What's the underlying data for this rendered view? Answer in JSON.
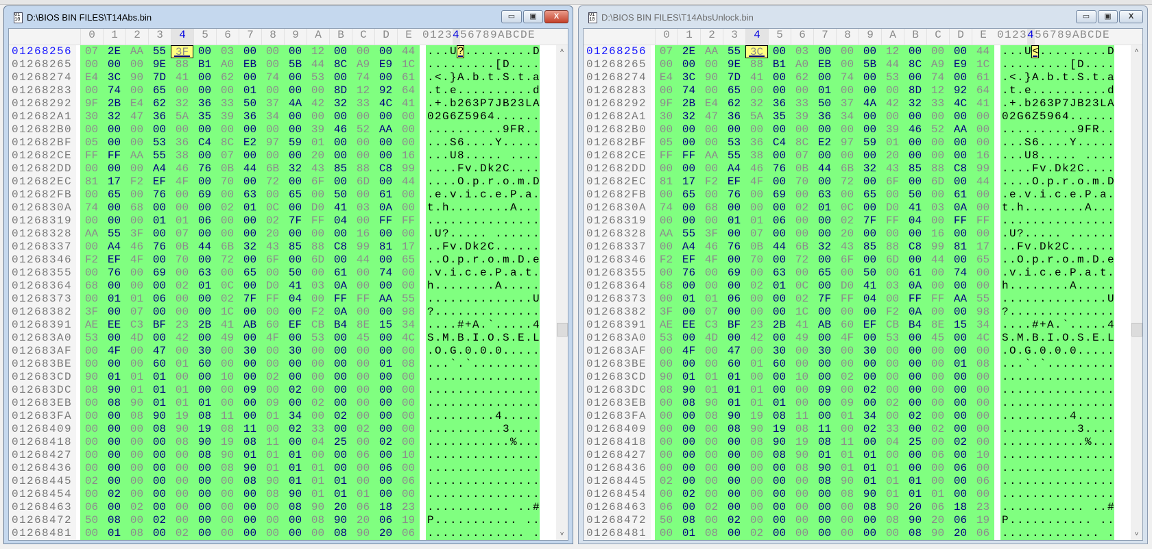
{
  "columns": [
    "0",
    "1",
    "2",
    "3",
    "4",
    "5",
    "6",
    "7",
    "8",
    "9",
    "A",
    "B",
    "C",
    "D",
    "E"
  ],
  "ascii_header": "0123456789ABCDE",
  "cursor_column": 4,
  "window_buttons": {
    "minimize": "▭",
    "maximize": "▣",
    "close": "X"
  },
  "scrollbar": {
    "up": "˄",
    "down": "˅",
    "position_fraction": 0.55
  },
  "colors": {
    "data_bg": "#80ff80",
    "even_col": "#8c8c8c",
    "odd_col": "#000080",
    "cursor_bg": "#ffff80"
  },
  "panes": [
    {
      "title": "D:\\BIOS BIN FILES\\T14Abs.bin",
      "active": true,
      "rows": [
        {
          "addr": "01268256",
          "hex": "07 2E AA 55 3F 00 03 00 00 00 12 00 00 00 44",
          "ascii": "...U?.........D"
        },
        {
          "addr": "01268265",
          "hex": "00 00 00 9E 88 B1 A0 EB 00 5B 44 8C A9 E9 1C",
          "ascii": ".........[D...."
        },
        {
          "addr": "01268274",
          "hex": "E4 3C 90 7D 41 00 62 00 74 00 53 00 74 00 61",
          "ascii": ".<.}A.b.t.S.t.a"
        },
        {
          "addr": "01268283",
          "hex": "00 74 00 65 00 00 00 01 00 00 00 8D 12 92 64",
          "ascii": ".t.e..........d"
        },
        {
          "addr": "01268292",
          "hex": "9F 2B E4 62 32 36 33 50 37 4A 42 32 33 4C 41",
          "ascii": ".+.b263P7JB23LA"
        },
        {
          "addr": "012682A1",
          "hex": "30 32 47 36 5A 35 39 36 34 00 00 00 00 00 00",
          "ascii": "02G6Z5964......"
        },
        {
          "addr": "012682B0",
          "hex": "00 00 00 00 00 00 00 00 00 00 39 46 52 AA 00",
          "ascii": "..........9FR.."
        },
        {
          "addr": "012682BF",
          "hex": "05 00 00 53 36 C4 8C E2 97 59 01 00 00 00 00",
          "ascii": "...S6....Y....."
        },
        {
          "addr": "012682CE",
          "hex": "FF FF AA 55 38 00 07 00 00 00 20 00 00 00 16",
          "ascii": "...U8..... ...."
        },
        {
          "addr": "012682DD",
          "hex": "00 00 00 A4 46 76 0B 44 6B 32 43 85 88 C8 99",
          "ascii": "....Fv.Dk2C...."
        },
        {
          "addr": "012682EC",
          "hex": "81 17 F2 EF 4F 00 70 00 72 00 6F 00 6D 00 44",
          "ascii": "....O.p.r.o.m.D"
        },
        {
          "addr": "012682FB",
          "hex": "00 65 00 76 00 69 00 63 00 65 00 50 00 61 00",
          "ascii": ".e.v.i.c.e.P.a."
        },
        {
          "addr": "0126830A",
          "hex": "74 00 68 00 00 00 02 01 0C 00 D0 41 03 0A 00",
          "ascii": "t.h........A..."
        },
        {
          "addr": "01268319",
          "hex": "00 00 00 01 01 06 00 00 02 7F FF 04 00 FF FF",
          "ascii": "..............."
        },
        {
          "addr": "01268328",
          "hex": "AA 55 3F 00 07 00 00 00 20 00 00 00 16 00 00",
          "ascii": ".U?..... ......"
        },
        {
          "addr": "01268337",
          "hex": "00 A4 46 76 0B 44 6B 32 43 85 88 C8 99 81 17",
          "ascii": "..Fv.Dk2C......"
        },
        {
          "addr": "01268346",
          "hex": "F2 EF 4F 00 70 00 72 00 6F 00 6D 00 44 00 65",
          "ascii": "..O.p.r.o.m.D.e"
        },
        {
          "addr": "01268355",
          "hex": "00 76 00 69 00 63 00 65 00 50 00 61 00 74 00",
          "ascii": ".v.i.c.e.P.a.t."
        },
        {
          "addr": "01268364",
          "hex": "68 00 00 00 02 01 0C 00 D0 41 03 0A 00 00 00",
          "ascii": "h........A....."
        },
        {
          "addr": "01268373",
          "hex": "00 01 01 06 00 00 02 7F FF 04 00 FF FF AA 55",
          "ascii": "..............U"
        },
        {
          "addr": "01268382",
          "hex": "3F 00 07 00 00 00 1C 00 00 00 F2 0A 00 00 98",
          "ascii": "?.............."
        },
        {
          "addr": "01268391",
          "hex": "AE EE C3 BF 23 2B 41 AB 60 EF CB B4 8E 15 34",
          "ascii": "....#+A.`.....4"
        },
        {
          "addr": "012683A0",
          "hex": "53 00 4D 00 42 00 49 00 4F 00 53 00 45 00 4C",
          "ascii": "S.M.B.I.O.S.E.L"
        },
        {
          "addr": "012683AF",
          "hex": "00 4F 00 47 00 30 00 30 00 30 00 00 00 00 00",
          "ascii": ".O.G.0.0.0....."
        },
        {
          "addr": "012683BE",
          "hex": "00 00 00 60 01 60 00 00 00 00 00 00 00 01 08",
          "ascii": "...`.`........."
        },
        {
          "addr": "012683CD",
          "hex": "90 01 01 01 00 00 10 00 02 00 00 00 00 00 00",
          "ascii": "..............."
        },
        {
          "addr": "012683DC",
          "hex": "08 90 01 01 01 00 00 09 00 02 00 00 00 00 00",
          "ascii": "..............."
        },
        {
          "addr": "012683EB",
          "hex": "00 08 90 01 01 01 00 00 09 00 02 00 00 00 00",
          "ascii": "..............."
        },
        {
          "addr": "012683FA",
          "hex": "00 00 08 90 19 08 11 00 01 34 00 02 00 00 00",
          "ascii": ".........4....."
        },
        {
          "addr": "01268409",
          "hex": "00 00 00 08 90 19 08 11 00 02 33 00 02 00 00",
          "ascii": "..........3...."
        },
        {
          "addr": "01268418",
          "hex": "00 00 00 00 08 90 19 08 11 00 04 25 00 02 00",
          "ascii": "...........%..."
        },
        {
          "addr": "01268427",
          "hex": "00 00 00 00 00 08 90 01 01 01 00 00 06 00 10",
          "ascii": "..............."
        },
        {
          "addr": "01268436",
          "hex": "00 00 00 00 00 00 08 90 01 01 01 00 00 06 00",
          "ascii": "..............."
        },
        {
          "addr": "01268445",
          "hex": "02 00 00 00 00 00 00 08 90 01 01 01 00 00 06",
          "ascii": "..............."
        },
        {
          "addr": "01268454",
          "hex": "00 02 00 00 00 00 00 00 08 90 01 01 01 00 00",
          "ascii": "..............."
        },
        {
          "addr": "01268463",
          "hex": "06 00 02 00 00 00 00 00 00 08 90 20 06 18 23",
          "ascii": "........... ..#"
        },
        {
          "addr": "01268472",
          "hex": "50 08 00 02 00 00 00 00 00 00 08 90 20 06 19",
          "ascii": "P........... .."
        },
        {
          "addr": "01268481",
          "hex": "00 01 08 00 02 00 00 00 00 00 00 08 90 20 06",
          "ascii": "............. ."
        }
      ]
    },
    {
      "title": "D:\\BIOS BIN FILES\\T14AbsUnlock.bin",
      "active": false,
      "rows": [
        {
          "addr": "01268256",
          "hex": "07 2E AA 55 3C 00 03 00 00 00 12 00 00 00 44",
          "ascii": "...U<.........D"
        },
        {
          "addr": "01268265",
          "hex": "00 00 00 9E 88 B1 A0 EB 00 5B 44 8C A9 E9 1C",
          "ascii": ".........[D...."
        },
        {
          "addr": "01268274",
          "hex": "E4 3C 90 7D 41 00 62 00 74 00 53 00 74 00 61",
          "ascii": ".<.}A.b.t.S.t.a"
        },
        {
          "addr": "01268283",
          "hex": "00 74 00 65 00 00 00 01 00 00 00 8D 12 92 64",
          "ascii": ".t.e..........d"
        },
        {
          "addr": "01268292",
          "hex": "9F 2B E4 62 32 36 33 50 37 4A 42 32 33 4C 41",
          "ascii": ".+.b263P7JB23LA"
        },
        {
          "addr": "012682A1",
          "hex": "30 32 47 36 5A 35 39 36 34 00 00 00 00 00 00",
          "ascii": "02G6Z5964......"
        },
        {
          "addr": "012682B0",
          "hex": "00 00 00 00 00 00 00 00 00 00 39 46 52 AA 00",
          "ascii": "..........9FR.."
        },
        {
          "addr": "012682BF",
          "hex": "05 00 00 53 36 C4 8C E2 97 59 01 00 00 00 00",
          "ascii": "...S6....Y....."
        },
        {
          "addr": "012682CE",
          "hex": "FF FF AA 55 38 00 07 00 00 00 20 00 00 00 16",
          "ascii": "...U8..... ...."
        },
        {
          "addr": "012682DD",
          "hex": "00 00 00 A4 46 76 0B 44 6B 32 43 85 88 C8 99",
          "ascii": "....Fv.Dk2C...."
        },
        {
          "addr": "012682EC",
          "hex": "81 17 F2 EF 4F 00 70 00 72 00 6F 00 6D 00 44",
          "ascii": "....O.p.r.o.m.D"
        },
        {
          "addr": "012682FB",
          "hex": "00 65 00 76 00 69 00 63 00 65 00 50 00 61 00",
          "ascii": ".e.v.i.c.e.P.a."
        },
        {
          "addr": "0126830A",
          "hex": "74 00 68 00 00 00 02 01 0C 00 D0 41 03 0A 00",
          "ascii": "t.h........A..."
        },
        {
          "addr": "01268319",
          "hex": "00 00 00 01 01 06 00 00 02 7F FF 04 00 FF FF",
          "ascii": "..............."
        },
        {
          "addr": "01268328",
          "hex": "AA 55 3F 00 07 00 00 00 20 00 00 00 16 00 00",
          "ascii": ".U?..... ......"
        },
        {
          "addr": "01268337",
          "hex": "00 A4 46 76 0B 44 6B 32 43 85 88 C8 99 81 17",
          "ascii": "..Fv.Dk2C......"
        },
        {
          "addr": "01268346",
          "hex": "F2 EF 4F 00 70 00 72 00 6F 00 6D 00 44 00 65",
          "ascii": "..O.p.r.o.m.D.e"
        },
        {
          "addr": "01268355",
          "hex": "00 76 00 69 00 63 00 65 00 50 00 61 00 74 00",
          "ascii": ".v.i.c.e.P.a.t."
        },
        {
          "addr": "01268364",
          "hex": "68 00 00 00 02 01 0C 00 D0 41 03 0A 00 00 00",
          "ascii": "h........A....."
        },
        {
          "addr": "01268373",
          "hex": "00 01 01 06 00 00 02 7F FF 04 00 FF FF AA 55",
          "ascii": "..............U"
        },
        {
          "addr": "01268382",
          "hex": "3F 00 07 00 00 00 1C 00 00 00 F2 0A 00 00 98",
          "ascii": "?.............."
        },
        {
          "addr": "01268391",
          "hex": "AE EE C3 BF 23 2B 41 AB 60 EF CB B4 8E 15 34",
          "ascii": "....#+A.`.....4"
        },
        {
          "addr": "012683A0",
          "hex": "53 00 4D 00 42 00 49 00 4F 00 53 00 45 00 4C",
          "ascii": "S.M.B.I.O.S.E.L"
        },
        {
          "addr": "012683AF",
          "hex": "00 4F 00 47 00 30 00 30 00 30 00 00 00 00 00",
          "ascii": ".O.G.0.0.0....."
        },
        {
          "addr": "012683BE",
          "hex": "00 00 00 60 01 60 00 00 00 00 00 00 00 01 08",
          "ascii": "...`.`........."
        },
        {
          "addr": "012683CD",
          "hex": "90 01 01 01 00 00 10 00 02 00 00 00 00 00 00",
          "ascii": "..............."
        },
        {
          "addr": "012683DC",
          "hex": "08 90 01 01 01 00 00 09 00 02 00 00 00 00 00",
          "ascii": "..............."
        },
        {
          "addr": "012683EB",
          "hex": "00 08 90 01 01 01 00 00 09 00 02 00 00 00 00",
          "ascii": "..............."
        },
        {
          "addr": "012683FA",
          "hex": "00 00 08 90 19 08 11 00 01 34 00 02 00 00 00",
          "ascii": ".........4....."
        },
        {
          "addr": "01268409",
          "hex": "00 00 00 08 90 19 08 11 00 02 33 00 02 00 00",
          "ascii": "..........3...."
        },
        {
          "addr": "01268418",
          "hex": "00 00 00 00 08 90 19 08 11 00 04 25 00 02 00",
          "ascii": "...........%..."
        },
        {
          "addr": "01268427",
          "hex": "00 00 00 00 00 08 90 01 01 01 00 00 06 00 10",
          "ascii": "..............."
        },
        {
          "addr": "01268436",
          "hex": "00 00 00 00 00 00 08 90 01 01 01 00 00 06 00",
          "ascii": "..............."
        },
        {
          "addr": "01268445",
          "hex": "02 00 00 00 00 00 00 08 90 01 01 01 00 00 06",
          "ascii": "..............."
        },
        {
          "addr": "01268454",
          "hex": "00 02 00 00 00 00 00 00 08 90 01 01 01 00 00",
          "ascii": "..............."
        },
        {
          "addr": "01268463",
          "hex": "06 00 02 00 00 00 00 00 00 08 90 20 06 18 23",
          "ascii": "........... ..#"
        },
        {
          "addr": "01268472",
          "hex": "50 08 00 02 00 00 00 00 00 00 08 90 20 06 19",
          "ascii": "P........... .."
        },
        {
          "addr": "01268481",
          "hex": "00 01 08 00 02 00 00 00 00 00 00 08 90 20 06",
          "ascii": "............. ."
        }
      ]
    }
  ]
}
